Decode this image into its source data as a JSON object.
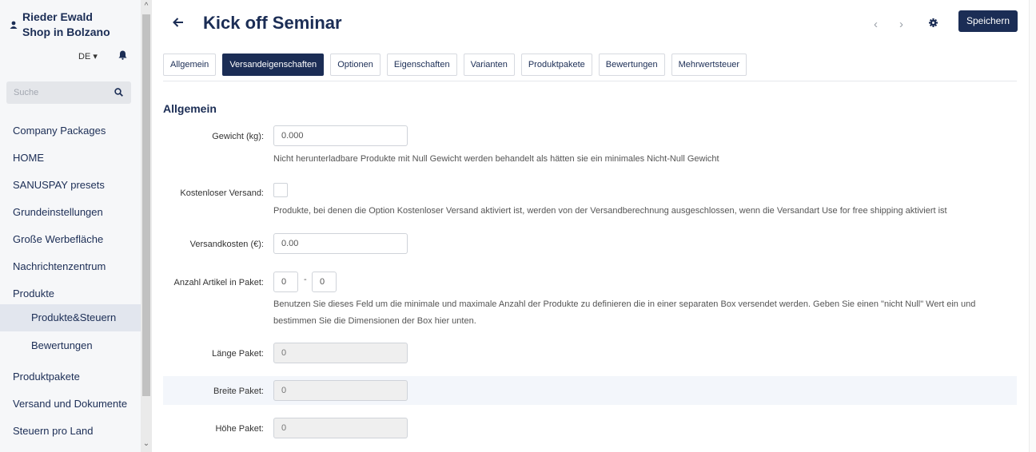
{
  "shop": {
    "name_line1": "Rieder Ewald",
    "name_line2": "Shop in Bolzano"
  },
  "lang": "DE ▾",
  "search": {
    "placeholder": "Suche"
  },
  "sidebar": {
    "items": [
      {
        "label": "Company Packages"
      },
      {
        "label": "HOME"
      },
      {
        "label": "SANUSPAY presets"
      },
      {
        "label": "Grundeinstellungen"
      },
      {
        "label": "Große Werbefläche"
      },
      {
        "label": "Nachrichtenzentrum"
      },
      {
        "label": "Produkte"
      },
      {
        "label": "Produkte&Steuern"
      },
      {
        "label": "Bewertungen"
      },
      {
        "label": "Produktpakete"
      },
      {
        "label": "Versand und Dokumente"
      },
      {
        "label": "Steuern pro Land"
      }
    ]
  },
  "header": {
    "title": "Kick off Seminar",
    "prev": "‹",
    "next": "›",
    "save_label": "Speichern"
  },
  "tabs": [
    {
      "label": "Allgemein"
    },
    {
      "label": "Versandeigenschaften"
    },
    {
      "label": "Optionen"
    },
    {
      "label": "Eigenschaften"
    },
    {
      "label": "Varianten"
    },
    {
      "label": "Produktpakete"
    },
    {
      "label": "Bewertungen"
    },
    {
      "label": "Mehrwertsteuer"
    }
  ],
  "section_title": "Allgemein",
  "form": {
    "weight": {
      "label": "Gewicht (kg):",
      "value": "0.000",
      "help": "Nicht herunterladbare Produkte mit Null Gewicht werden behandelt als hätten sie ein minimales Nicht-Null Gewicht"
    },
    "free_shipping": {
      "label": "Kostenloser Versand:",
      "help": "Produkte, bei denen die Option Kostenloser Versand aktiviert ist, werden von der Versandberechnung ausgeschlossen, wenn die Versandart Use for free shipping aktiviert ist"
    },
    "shipping_cost": {
      "label": "Versandkosten (€):",
      "value": "0.00"
    },
    "items_in_box": {
      "label": "Anzahl Artikel in Paket:",
      "min": "0",
      "max": "0",
      "separator": "-",
      "help_line1": "Benutzen Sie dieses Feld um die minimale und maximale Anzahl der Produkte zu definieren die in einer separaten Box versendet werden. Geben Sie einen \"nicht Null\" Wert ein und",
      "help_line2": "bestimmen Sie die Dimensionen der Box hier unten."
    },
    "box_length": {
      "label": "Länge Paket:",
      "value": "0"
    },
    "box_width": {
      "label": "Breite Paket:",
      "value": "0"
    },
    "box_height": {
      "label": "Höhe Paket:",
      "value": "0"
    }
  }
}
